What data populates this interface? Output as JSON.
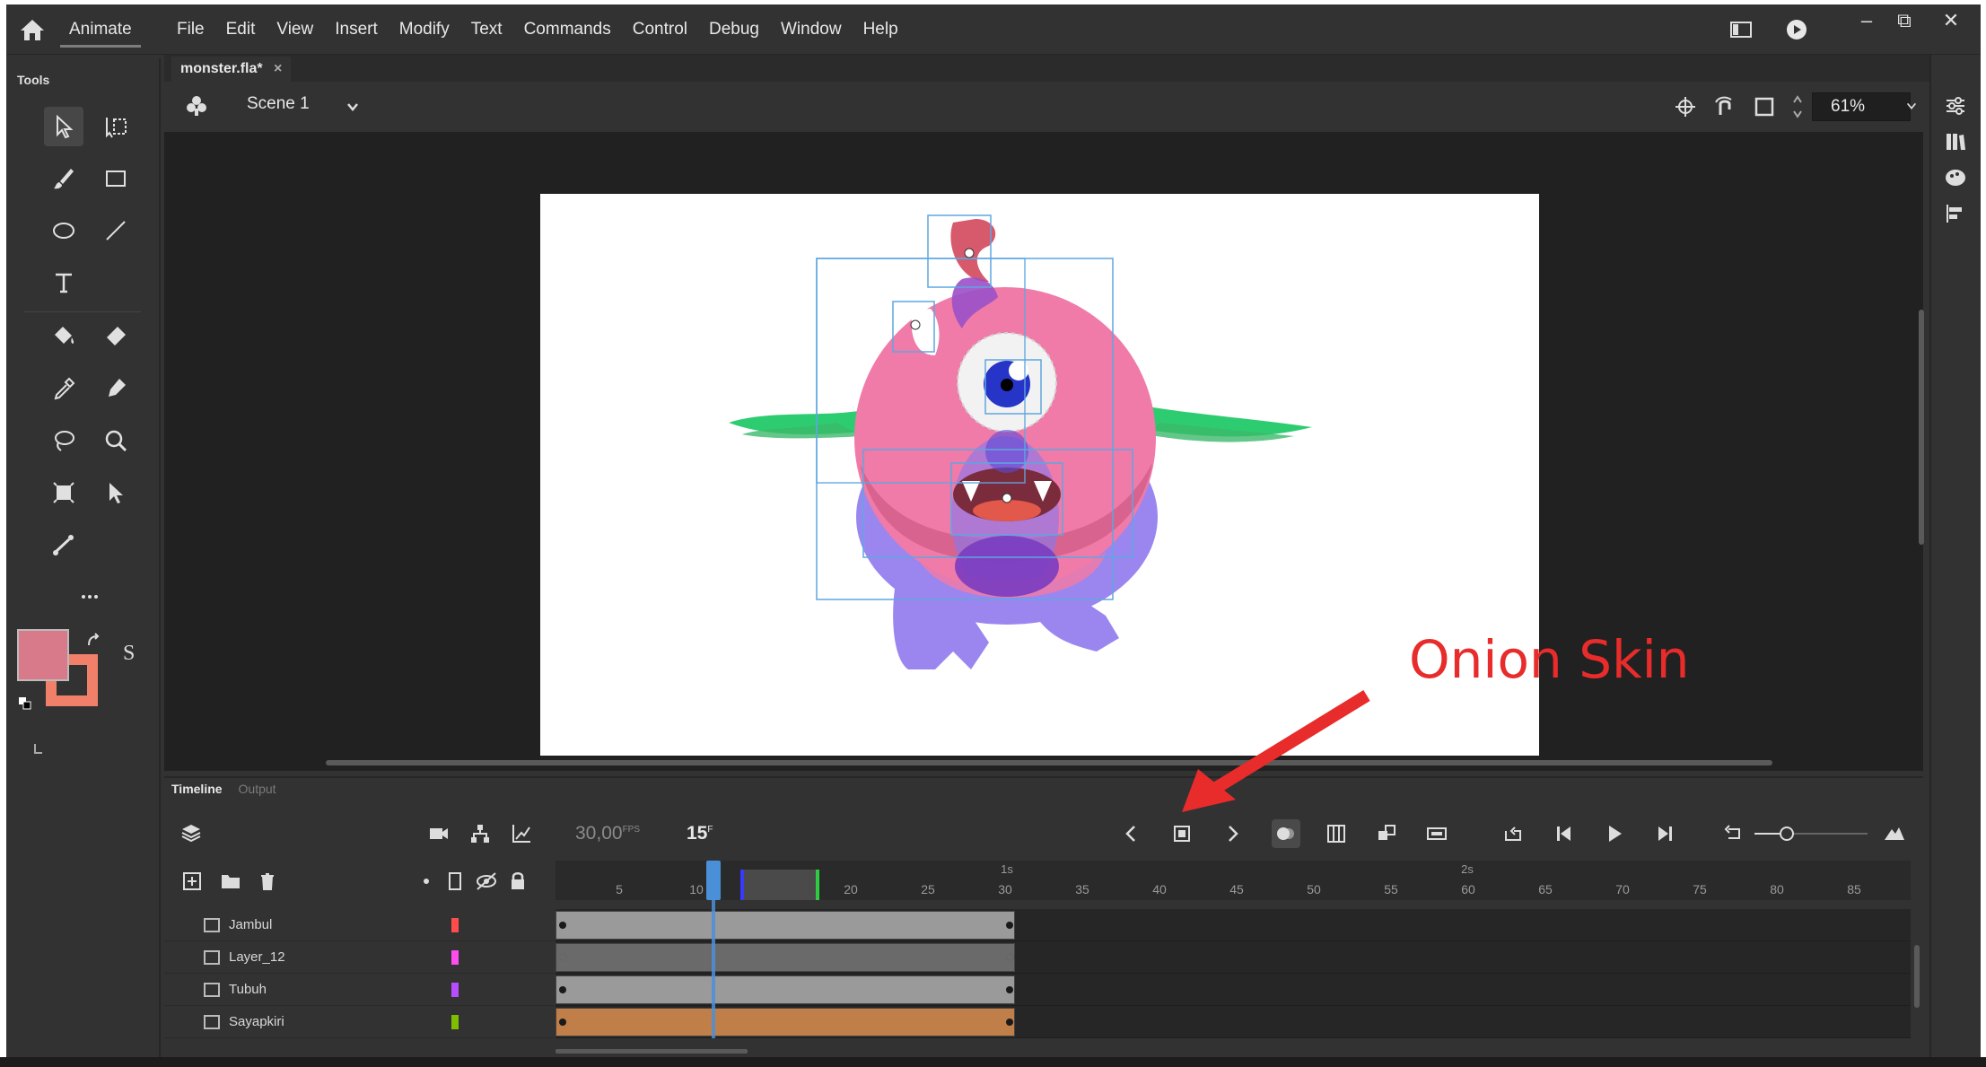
{
  "app": {
    "name": "Animate"
  },
  "menu": [
    "File",
    "Edit",
    "View",
    "Insert",
    "Modify",
    "Text",
    "Commands",
    "Control",
    "Debug",
    "Window",
    "Help"
  ],
  "tools_panel": {
    "title": "Tools"
  },
  "document": {
    "tab_label": "monster.fla*",
    "close_glyph": "×"
  },
  "editbar": {
    "scene_label": "Scene 1",
    "zoom_value": "61%"
  },
  "stroke_label": "S",
  "timeline": {
    "tabs": [
      {
        "label": "Timeline",
        "active": true
      },
      {
        "label": "Output",
        "active": false
      }
    ],
    "fps_value": "30,00",
    "fps_unit": "FPS",
    "current_frame": "15",
    "current_frame_unit": "F",
    "ruler_ticks": [
      "5",
      "10",
      "15",
      "20",
      "25",
      "30",
      "35",
      "40",
      "45",
      "50",
      "55",
      "60",
      "65",
      "70",
      "75",
      "80",
      "85"
    ],
    "seconds_markers": [
      "1s",
      "2s"
    ],
    "layers": [
      {
        "name": "Jambul",
        "color": "#ff4d4d"
      },
      {
        "name": "Layer_12",
        "color": "#ff4df0"
      },
      {
        "name": "Tubuh",
        "color": "#b84dff"
      },
      {
        "name": "Sayapkiri",
        "color": "#7fbf00"
      }
    ]
  },
  "annotation": {
    "text": "Onion Skin",
    "color": "#e82b2b"
  },
  "colors": {
    "fill": "#d97a8a",
    "stroke": "#f0806a",
    "playhead": "#4a90d9",
    "tween": "#c07e48"
  },
  "icons": {
    "home": "home-icon",
    "onion_skin": "onion-skin-icon",
    "play": "play-icon",
    "selection": "arrow-icon"
  }
}
